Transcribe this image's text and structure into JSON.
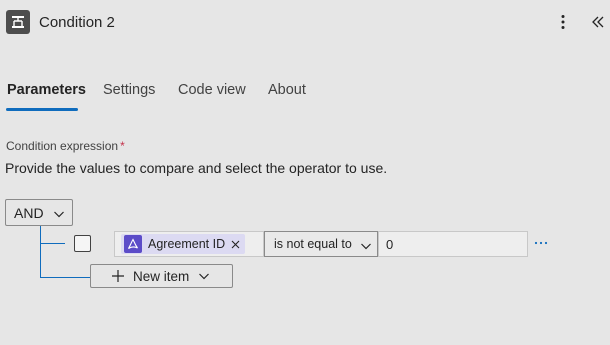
{
  "header": {
    "title": "Condition 2",
    "icon": "condition-icon",
    "more_icon": "more-vertical-icon",
    "collapse_icon": "double-chevron-left-icon"
  },
  "tabs": [
    {
      "label": "Parameters",
      "active": true
    },
    {
      "label": "Settings",
      "active": false
    },
    {
      "label": "Code view",
      "active": false
    },
    {
      "label": "About",
      "active": false
    }
  ],
  "condition": {
    "label": "Condition expression",
    "required_marker": "*",
    "description": "Provide the values to compare and select the operator to use.",
    "group_operator": "AND",
    "rows": [
      {
        "left_token": {
          "label": "Agreement ID",
          "icon": "adobe-acrobat-sign-icon"
        },
        "operator": "is not equal to",
        "right_value": "0"
      }
    ],
    "new_item_label": "New item"
  },
  "colors": {
    "accent": "#0f6cbd",
    "token_bg": "#dcdaf2",
    "token_icon_bg": "#5c4cc8",
    "required": "#c4314b"
  }
}
